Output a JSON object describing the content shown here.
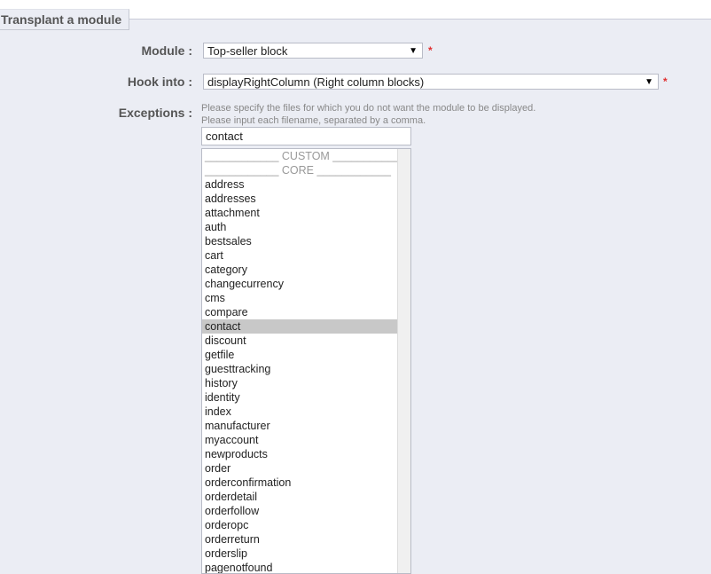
{
  "fieldset": {
    "legend": "Transplant a module"
  },
  "module": {
    "label": "Module :",
    "value": "Top-seller block",
    "required": "*"
  },
  "hook": {
    "label": "Hook into :",
    "value": "displayRightColumn (Right column blocks)",
    "required": "*"
  },
  "exceptions": {
    "label": "Exceptions :",
    "hint1": "Please specify the files for which you do not want the module to be displayed.",
    "hint2": "Please input each filename, separated by a comma.",
    "input_value": "contact",
    "options": [
      {
        "text": "____________ CUSTOM ____________",
        "type": "sep"
      },
      {
        "text": "____________ CORE ____________",
        "type": "sep"
      },
      {
        "text": "address",
        "type": "opt"
      },
      {
        "text": "addresses",
        "type": "opt"
      },
      {
        "text": "attachment",
        "type": "opt"
      },
      {
        "text": "auth",
        "type": "opt"
      },
      {
        "text": "bestsales",
        "type": "opt"
      },
      {
        "text": "cart",
        "type": "opt"
      },
      {
        "text": "category",
        "type": "opt"
      },
      {
        "text": "changecurrency",
        "type": "opt"
      },
      {
        "text": "cms",
        "type": "opt"
      },
      {
        "text": "compare",
        "type": "opt"
      },
      {
        "text": "contact",
        "type": "sel"
      },
      {
        "text": "discount",
        "type": "opt"
      },
      {
        "text": "getfile",
        "type": "opt"
      },
      {
        "text": "guesttracking",
        "type": "opt"
      },
      {
        "text": "history",
        "type": "opt"
      },
      {
        "text": "identity",
        "type": "opt"
      },
      {
        "text": "index",
        "type": "opt"
      },
      {
        "text": "manufacturer",
        "type": "opt"
      },
      {
        "text": "myaccount",
        "type": "opt"
      },
      {
        "text": "newproducts",
        "type": "opt"
      },
      {
        "text": "order",
        "type": "opt"
      },
      {
        "text": "orderconfirmation",
        "type": "opt"
      },
      {
        "text": "orderdetail",
        "type": "opt"
      },
      {
        "text": "orderfollow",
        "type": "opt"
      },
      {
        "text": "orderopc",
        "type": "opt"
      },
      {
        "text": "orderreturn",
        "type": "opt"
      },
      {
        "text": "orderslip",
        "type": "opt"
      },
      {
        "text": "pagenotfound",
        "type": "opt"
      }
    ]
  },
  "icons": {
    "dropdown": "triangle-down-icon"
  }
}
